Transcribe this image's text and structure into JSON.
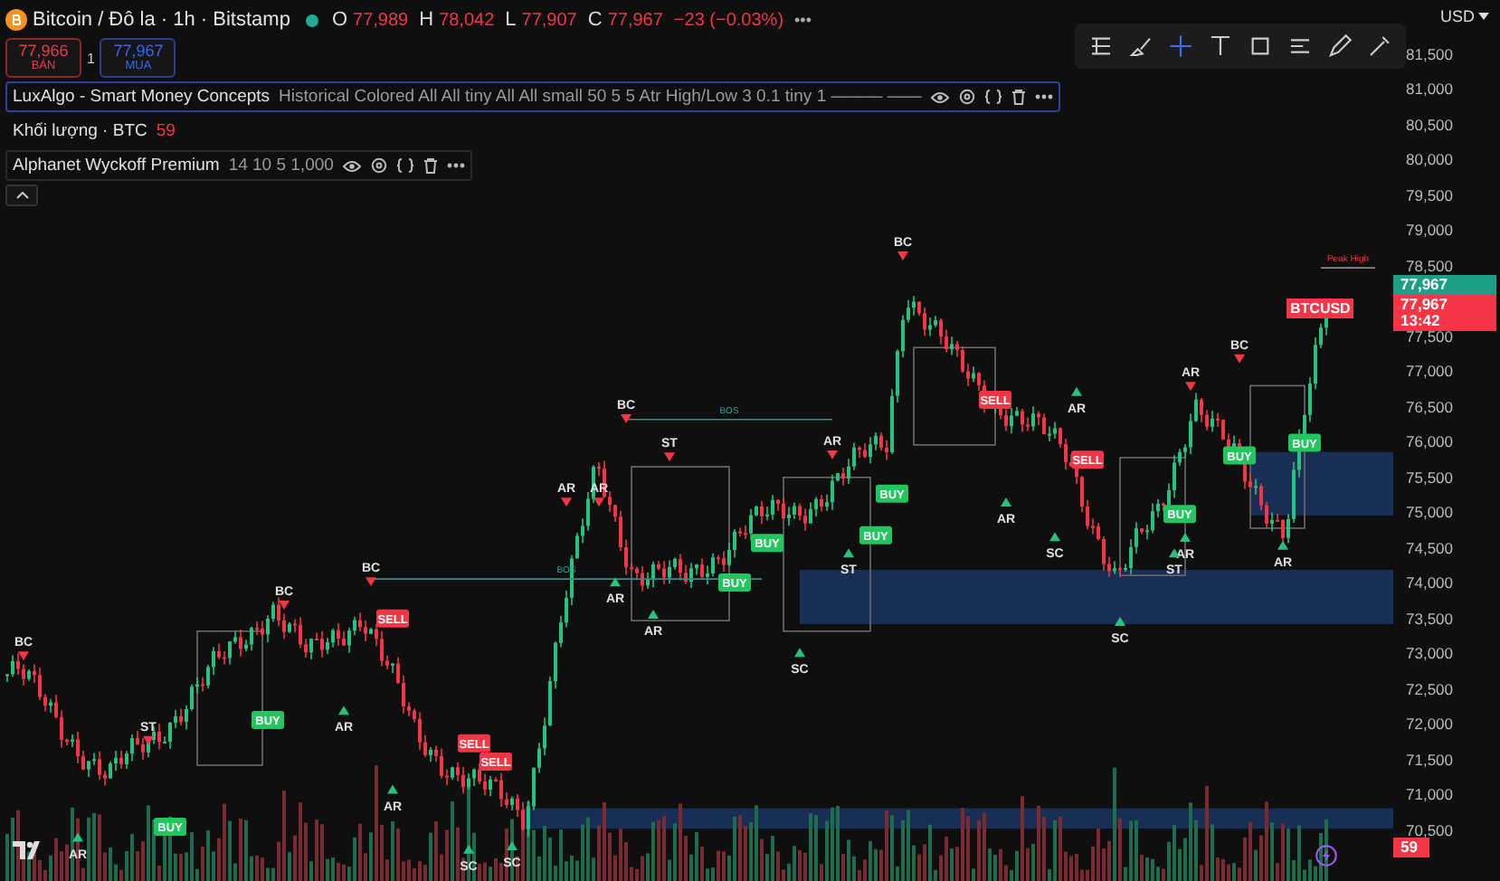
{
  "symbol": {
    "title": "Bitcoin / Đô la · 1h · Bitstamp",
    "market_open": true,
    "ohlc": [
      {
        "label": "O",
        "value": "77,989"
      },
      {
        "label": "H",
        "value": "78,042"
      },
      {
        "label": "L",
        "value": "77,907"
      },
      {
        "label": "C",
        "value": "77,967"
      }
    ],
    "change": "−23 (−0.03%)",
    "more": "•••"
  },
  "quote": {
    "sell_price": "77,966",
    "sell_label": "BÁN",
    "spread": "1",
    "buy_price": "77,967",
    "buy_label": "MUA"
  },
  "indicators": [
    {
      "name": "LuxAlgo - Smart Money Concepts",
      "params": "Historical Colored All All tiny All All small 50 5 5 Atr High/Low 3 0.1 tiny 1 ——— ——",
      "selected": true,
      "tools": true
    },
    {
      "name": "Khối lượng · BTC",
      "params": "59",
      "selected": false,
      "tools": false
    },
    {
      "name": "Alphanet Wyckoff Premium",
      "params": "14 10 5 1,000",
      "selected": false,
      "tools": true
    }
  ],
  "toolbar": [
    {
      "kind": "fib",
      "selected": false
    },
    {
      "kind": "brush",
      "selected": false
    },
    {
      "kind": "cross",
      "selected": true
    },
    {
      "kind": "text",
      "selected": false
    },
    {
      "kind": "rect",
      "selected": false
    },
    {
      "kind": "lines",
      "selected": false
    },
    {
      "kind": "pencil",
      "selected": false
    },
    {
      "kind": "picker",
      "selected": false
    }
  ],
  "price_axis": {
    "currency": "USD",
    "ticks": [
      "81,500",
      "81,000",
      "80,500",
      "80,000",
      "79,500",
      "79,000",
      "78,500",
      "77,500",
      "77,000",
      "76,500",
      "76,000",
      "75,500",
      "75,000",
      "74,500",
      "74,000",
      "73,500",
      "73,000",
      "72,500",
      "72,000",
      "71,500",
      "71,000",
      "70,500"
    ],
    "last_price": "77,967",
    "symbol_tag": "BTCUSD",
    "countdown_price": "77,967",
    "countdown": "13:42",
    "volume_tag": "59"
  },
  "structure_lines": [
    {
      "label": "BOS"
    },
    {
      "label": "BOS"
    },
    {
      "label": "Peak High"
    }
  ],
  "markers": [
    {
      "kind": "wyckoff",
      "label": "BC"
    },
    {
      "kind": "wyckoff",
      "label": "AR"
    },
    {
      "kind": "wyckoff",
      "label": "ST"
    },
    {
      "kind": "wyckoff",
      "label": "BC"
    },
    {
      "kind": "wyckoff",
      "label": "BC"
    },
    {
      "kind": "wyckoff",
      "label": "AR"
    },
    {
      "kind": "wyckoff",
      "label": "AR"
    },
    {
      "kind": "wyckoff",
      "label": "SC"
    },
    {
      "kind": "wyckoff",
      "label": "SC"
    },
    {
      "kind": "wyckoff",
      "label": "AR"
    },
    {
      "kind": "wyckoff",
      "label": "AR"
    },
    {
      "kind": "wyckoff",
      "label": "BC"
    },
    {
      "kind": "wyckoff",
      "label": "ST"
    },
    {
      "kind": "wyckoff",
      "label": "AR"
    },
    {
      "kind": "wyckoff",
      "label": "AR"
    },
    {
      "kind": "wyckoff",
      "label": "ST"
    },
    {
      "kind": "wyckoff",
      "label": "SC"
    },
    {
      "kind": "wyckoff",
      "label": "BC"
    },
    {
      "kind": "wyckoff",
      "label": "AR"
    },
    {
      "kind": "wyckoff",
      "label": "AR"
    },
    {
      "kind": "wyckoff",
      "label": "AR"
    },
    {
      "kind": "wyckoff",
      "label": "SC"
    },
    {
      "kind": "wyckoff",
      "label": "AR"
    },
    {
      "kind": "wyckoff",
      "label": "BC"
    },
    {
      "kind": "wyckoff",
      "label": "AR"
    },
    {
      "kind": "wyckoff",
      "label": "ST"
    },
    {
      "kind": "wyckoff",
      "label": "AR"
    },
    {
      "kind": "wyckoff",
      "label": "SC"
    },
    {
      "kind": "sell",
      "label": "SELL"
    },
    {
      "kind": "buy",
      "label": "BUY"
    },
    {
      "kind": "buy",
      "label": "BUY"
    },
    {
      "kind": "sell",
      "label": "SELL"
    },
    {
      "kind": "sell",
      "label": "SELL"
    },
    {
      "kind": "buy",
      "label": "BUY"
    },
    {
      "kind": "buy",
      "label": "BUY"
    },
    {
      "kind": "buy",
      "label": "BUY"
    },
    {
      "kind": "buy",
      "label": "BUY"
    },
    {
      "kind": "sell",
      "label": "SELL"
    },
    {
      "kind": "sell",
      "label": "SELL"
    },
    {
      "kind": "buy",
      "label": "BUY"
    },
    {
      "kind": "buy",
      "label": "BUY"
    },
    {
      "kind": "buy",
      "label": "BUY"
    }
  ]
}
